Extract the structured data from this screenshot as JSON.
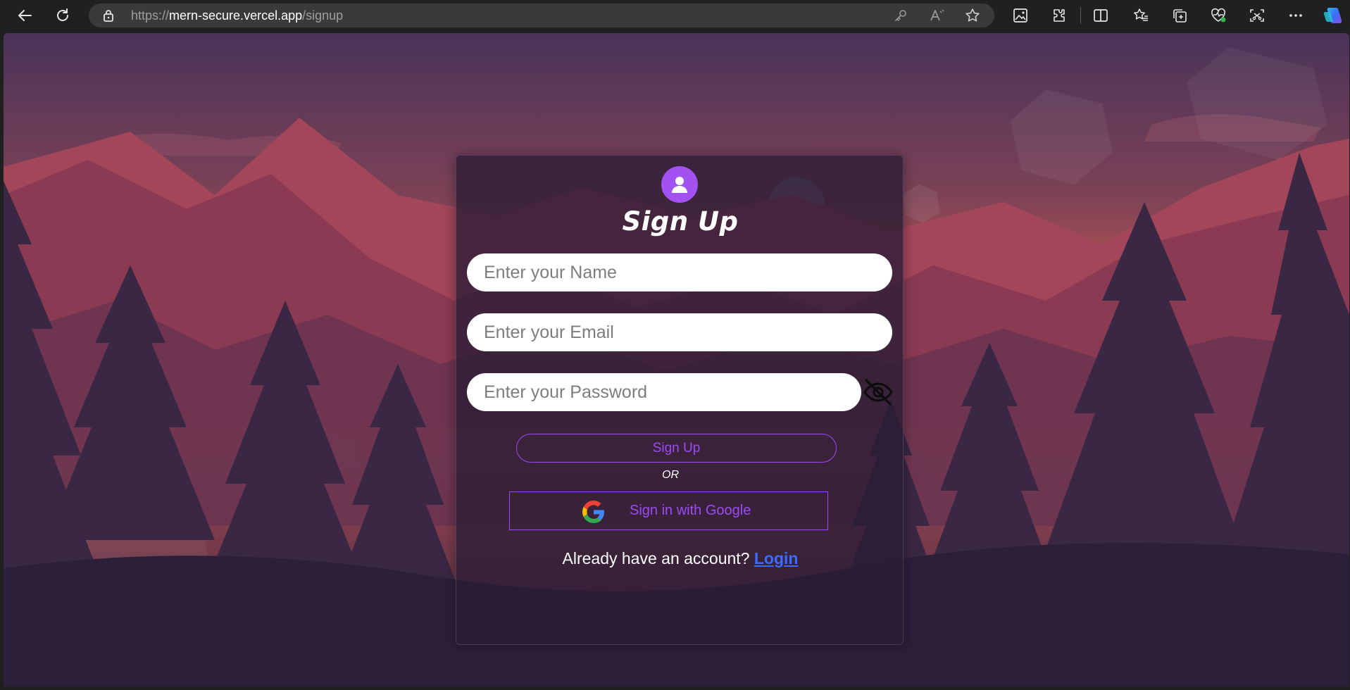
{
  "browser": {
    "url_scheme": "https://",
    "url_host": "mern-secure.vercel.app",
    "url_path": "/signup",
    "icons": [
      "back-icon",
      "refresh-icon",
      "lock-icon",
      "key-icon",
      "read-aloud-icon",
      "favorite-star-icon",
      "image-icon",
      "extensions-icon",
      "split-screen-icon",
      "favorites-icon",
      "collections-icon",
      "browser-essentials-icon",
      "screenshot-icon",
      "more-icon",
      "copilot-icon"
    ]
  },
  "signup": {
    "title": "Sign Up",
    "name_placeholder": "Enter your Name",
    "email_placeholder": "Enter your Email",
    "password_placeholder": "Enter your Password",
    "signup_button": "Sign Up",
    "or_text": "OR",
    "google_button": "Sign in with Google",
    "already_text": "Already have an account?",
    "login_link": "Login"
  },
  "colors": {
    "accent": "#9b4cf0",
    "avatar": "#a352f2",
    "link": "#3b6bff"
  }
}
